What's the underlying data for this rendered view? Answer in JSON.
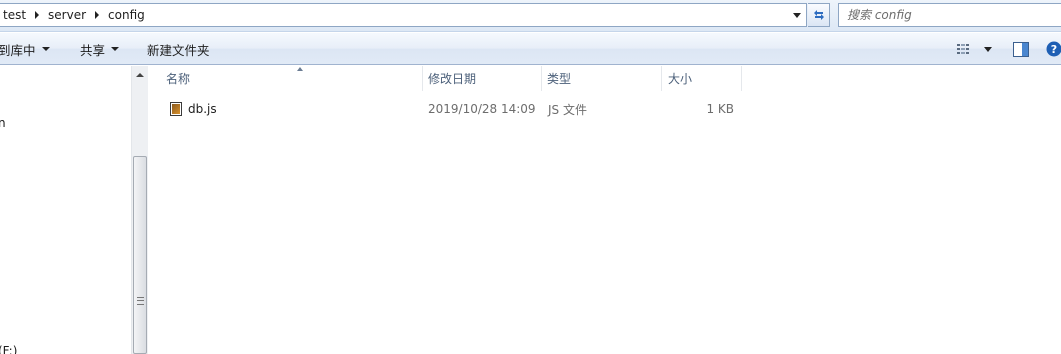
{
  "address_bar": {
    "crumbs": [
      "test",
      "server",
      "config"
    ]
  },
  "search": {
    "placeholder": "搜索 config"
  },
  "command_bar": {
    "include_in_library": "到库中",
    "share": "共享",
    "new_folder": "新建文件夹"
  },
  "nav_pane": {
    "partial_item_1": "n",
    "partial_item_2": "(F:)"
  },
  "columns": {
    "name": "名称",
    "modified": "修改日期",
    "type": "类型",
    "size": "大小"
  },
  "files": [
    {
      "name": "db.js",
      "modified": "2019/10/28 14:09",
      "type": "JS 文件",
      "size": "1 KB"
    }
  ],
  "icons": {
    "refresh": "refresh-icon",
    "views": "views-icon",
    "preview_pane": "preview-pane-icon",
    "help": "help-icon",
    "file": "js-file-icon"
  },
  "colors": {
    "header_text": "#4c607a",
    "help_blue": "#1e5fb4"
  }
}
